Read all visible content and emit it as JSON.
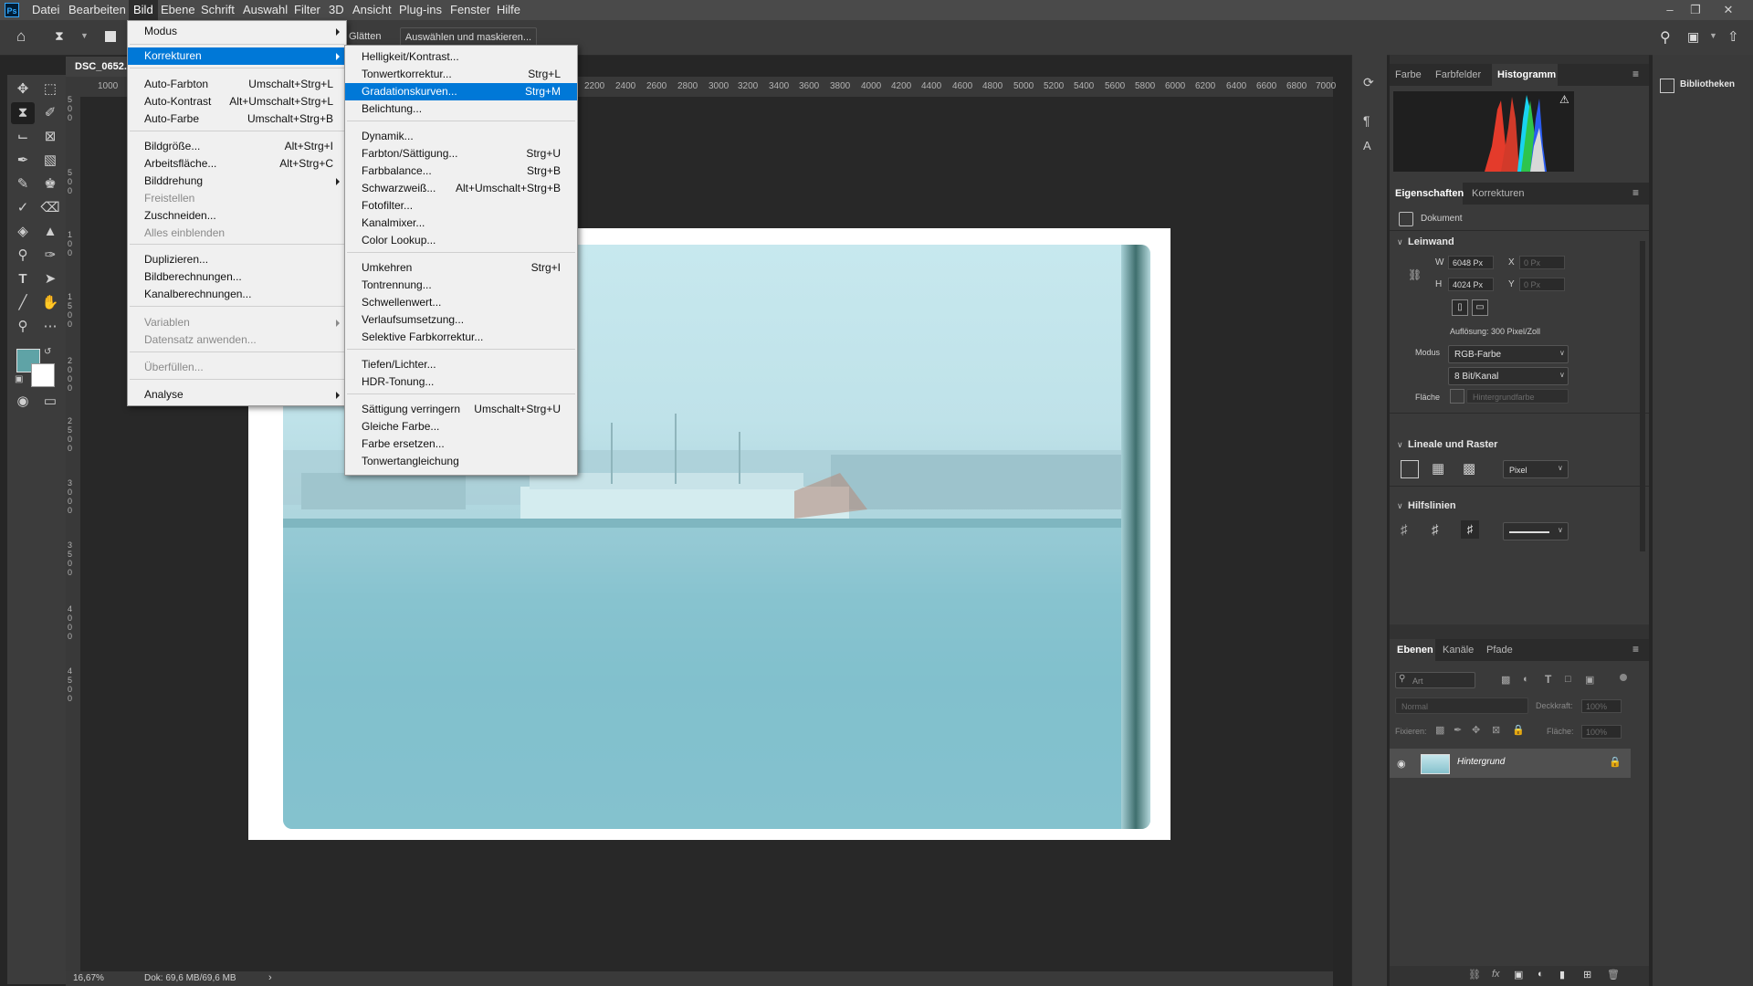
{
  "app": {
    "logo": "Ps"
  },
  "menubar": {
    "items": [
      "Datei",
      "Bearbeiten",
      "Bild",
      "Ebene",
      "Schrift",
      "Auswahl",
      "Filter",
      "3D",
      "Ansicht",
      "Plug-ins",
      "Fenster",
      "Hilfe"
    ],
    "active": "Bild"
  },
  "options": {
    "smooth_label": "Glätten",
    "select_mask_label": "Auswählen und maskieren..."
  },
  "document": {
    "tab_title": "DSC_0652...",
    "zoom": "16,67%",
    "doc_size": "Dok: 69,6 MB/69,6 MB",
    "ruler_top": [
      "1000",
      "2200",
      "2400",
      "2600",
      "2800",
      "3000",
      "3200",
      "3400",
      "3600",
      "3800",
      "4000",
      "4200",
      "4400",
      "4600",
      "4800",
      "5000",
      "5200",
      "5400",
      "5600",
      "5800",
      "6000",
      "6200",
      "6400",
      "6600",
      "6800",
      "7000"
    ],
    "ruler_left": [
      "5",
      "0",
      "0",
      "5",
      "0",
      "0",
      "1",
      "0",
      "0",
      "1",
      "5",
      "0",
      "0",
      "2",
      "0",
      "0",
      "0",
      "2",
      "5",
      "0",
      "0",
      "3",
      "0",
      "0",
      "0",
      "3",
      "5",
      "0",
      "0",
      "4",
      "0",
      "0",
      "0",
      "4",
      "5",
      "0",
      "0"
    ]
  },
  "bild_menu": {
    "items": [
      {
        "label": "Modus",
        "shortcut": "",
        "sub": true,
        "disabled": false
      },
      {
        "label": "Korrekturen",
        "shortcut": "",
        "sub": true,
        "disabled": false,
        "highlight": true
      },
      {
        "label": "Auto-Farbton",
        "shortcut": "Umschalt+Strg+L"
      },
      {
        "label": "Auto-Kontrast",
        "shortcut": "Alt+Umschalt+Strg+L"
      },
      {
        "label": "Auto-Farbe",
        "shortcut": "Umschalt+Strg+B"
      },
      {
        "label": "Bildgröße...",
        "shortcut": "Alt+Strg+I"
      },
      {
        "label": "Arbeitsfläche...",
        "shortcut": "Alt+Strg+C"
      },
      {
        "label": "Bilddrehung",
        "shortcut": "",
        "sub": true
      },
      {
        "label": "Freistellen",
        "shortcut": "",
        "disabled": true
      },
      {
        "label": "Zuschneiden...",
        "shortcut": ""
      },
      {
        "label": "Alles einblenden",
        "shortcut": "",
        "disabled": true
      },
      {
        "label": "Duplizieren...",
        "shortcut": ""
      },
      {
        "label": "Bildberechnungen...",
        "shortcut": ""
      },
      {
        "label": "Kanalberechnungen...",
        "shortcut": ""
      },
      {
        "label": "Variablen",
        "shortcut": "",
        "sub": true,
        "disabled": true
      },
      {
        "label": "Datensatz anwenden...",
        "shortcut": "",
        "disabled": true
      },
      {
        "label": "Überfüllen...",
        "shortcut": "",
        "disabled": true
      },
      {
        "label": "Analyse",
        "shortcut": "",
        "sub": true
      }
    ]
  },
  "korrekturen_menu": {
    "items": [
      {
        "label": "Helligkeit/Kontrast...",
        "shortcut": ""
      },
      {
        "label": "Tonwertkorrektur...",
        "shortcut": "Strg+L"
      },
      {
        "label": "Gradationskurven...",
        "shortcut": "Strg+M",
        "highlight": true
      },
      {
        "label": "Belichtung...",
        "shortcut": ""
      },
      {
        "label": "Dynamik...",
        "shortcut": ""
      },
      {
        "label": "Farbton/Sättigung...",
        "shortcut": "Strg+U"
      },
      {
        "label": "Farbbalance...",
        "shortcut": "Strg+B"
      },
      {
        "label": "Schwarzweiß...",
        "shortcut": "Alt+Umschalt+Strg+B"
      },
      {
        "label": "Fotofilter...",
        "shortcut": ""
      },
      {
        "label": "Kanalmixer...",
        "shortcut": ""
      },
      {
        "label": "Color Lookup...",
        "shortcut": ""
      },
      {
        "label": "Umkehren",
        "shortcut": "Strg+I"
      },
      {
        "label": "Tontrennung...",
        "shortcut": ""
      },
      {
        "label": "Schwellenwert...",
        "shortcut": ""
      },
      {
        "label": "Verlaufsumsetzung...",
        "shortcut": ""
      },
      {
        "label": "Selektive Farbkorrektur...",
        "shortcut": ""
      },
      {
        "label": "Tiefen/Lichter...",
        "shortcut": ""
      },
      {
        "label": "HDR-Tonung...",
        "shortcut": ""
      },
      {
        "label": "Sättigung verringern",
        "shortcut": "Umschalt+Strg+U"
      },
      {
        "label": "Gleiche Farbe...",
        "shortcut": ""
      },
      {
        "label": "Farbe ersetzen...",
        "shortcut": ""
      },
      {
        "label": "Tonwertangleichung",
        "shortcut": ""
      }
    ]
  },
  "panels": {
    "top_tabs": [
      "Farbe",
      "Farbfelder",
      "Histogramm"
    ],
    "props_tabs": [
      "Eigenschaften",
      "Korrekturen"
    ],
    "doc_label": "Dokument",
    "leinwand": {
      "heading": "Leinwand",
      "w_label": "W",
      "w_value": "6048 Px",
      "h_label": "H",
      "h_value": "4024 Px",
      "x_label": "X",
      "x_value": "0 Px",
      "y_label": "Y",
      "y_value": "0 Px",
      "resolution": "Auflösung: 300 Pixel/Zoll",
      "modus_label": "Modus",
      "modus_value": "RGB-Farbe",
      "bit_value": "8 Bit/Kanal",
      "flaeche_label": "Fläche",
      "flaeche_value": "Hintergrundfarbe"
    },
    "lineale": {
      "heading": "Lineale und Raster",
      "unit": "Pixel"
    },
    "hilfslinien": {
      "heading": "Hilfslinien"
    },
    "layers_tabs": [
      "Ebenen",
      "Kanäle",
      "Pfade"
    ],
    "layers": {
      "search_placeholder": "Art",
      "blend_mode": "Normal",
      "opacity_label": "Deckkraft:",
      "opacity_value": "100%",
      "lock_label": "Fixieren:",
      "fill_label": "Fläche:",
      "fill_value": "100%",
      "layer_name": "Hintergrund"
    },
    "libraries": "Bibliotheken"
  },
  "colors": {
    "foreground": "#5fa3a6",
    "background": "#ffffff",
    "accent": "#0078d7"
  }
}
